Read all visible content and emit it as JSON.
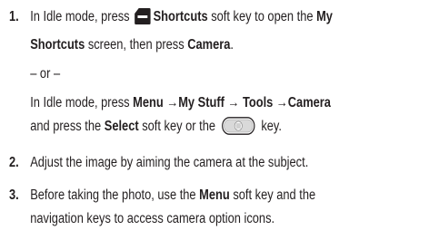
{
  "steps": [
    {
      "number": "1.",
      "line1_pre": "In Idle mode, press ",
      "line1_b1": "Shortcuts",
      "line1_mid": " soft key to open the ",
      "line1_b2": "My",
      "line2_b1": "Shortcuts",
      "line2_mid": " screen, then press ",
      "line2_b2": "Camera",
      "line2_end": ".",
      "or_text": "– or –",
      "alt1_pre": "In Idle mode, press ",
      "alt1_b": "Menu →My Stuff → Tools →Camera",
      "alt2_pre": "and press the ",
      "alt2_b": "Select",
      "alt2_mid": " soft key or the ",
      "alt2_end": " key."
    },
    {
      "number": "2.",
      "text": "Adjust the image by aiming the camera at the subject."
    },
    {
      "number": "3.",
      "line1_pre": "Before taking the photo, use the ",
      "line1_b": "Menu",
      "line1_end": " soft key and the",
      "line2": "navigation keys to access camera option icons."
    }
  ],
  "icons": {
    "softkey": "minus-softkey-icon",
    "select": "select-key-icon"
  },
  "colors": {
    "text": "#231f20",
    "icon": "#231f20"
  }
}
